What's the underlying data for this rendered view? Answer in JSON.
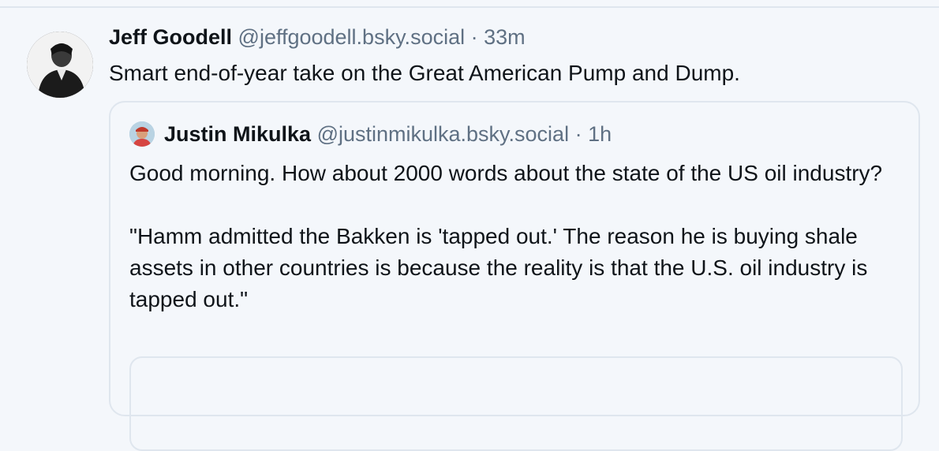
{
  "post": {
    "author_name": "Jeff Goodell",
    "author_handle": "@jeffgoodell.bsky.social",
    "separator": "·",
    "time": "33m",
    "text": "Smart end-of-year take on the Great American Pump and Dump."
  },
  "quote": {
    "author_name": "Justin Mikulka",
    "author_handle": "@justinmikulka.bsky.social",
    "separator": "·",
    "time": "1h",
    "paragraph_1": "Good morning. How about 2000 words about the state of the US oil industry?",
    "paragraph_2": "\"Hamm admitted the Bakken is 'tapped out.'  The reason he is buying shale assets in other countries is because the reality is that the U.S. oil industry is tapped out.\""
  },
  "colors": {
    "background": "#f4f7fb",
    "border": "#dfe6ee",
    "text": "#0f1419",
    "muted": "#5f7083"
  }
}
